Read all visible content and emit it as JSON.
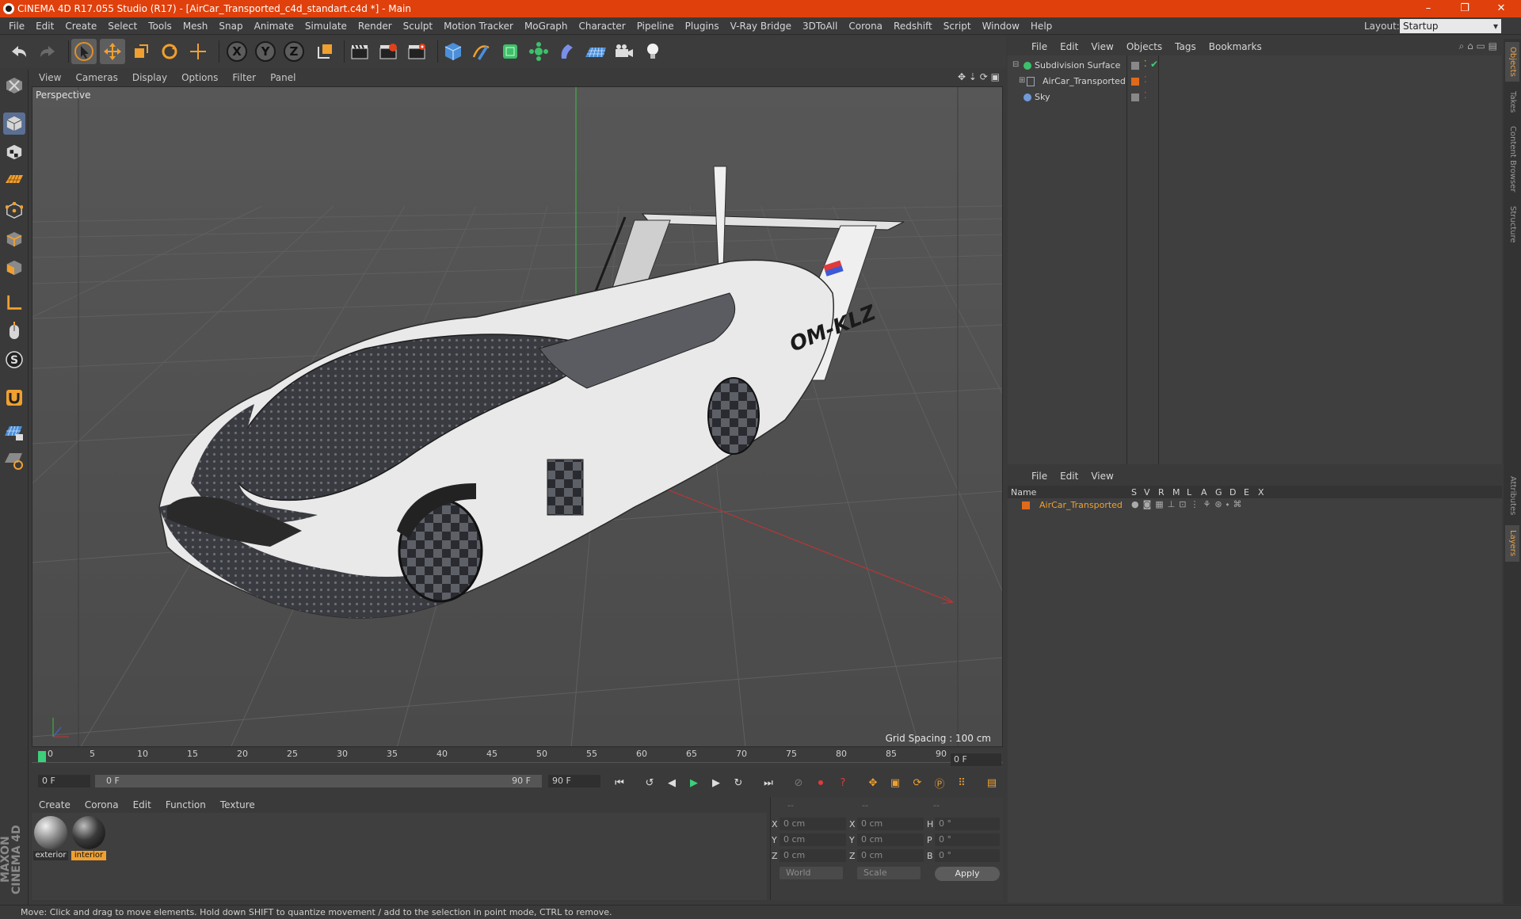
{
  "window": {
    "title": "CINEMA 4D R17.055 Studio (R17) - [AirCar_Transported_c4d_standart.c4d *] - Main",
    "controls": [
      "–",
      "❐",
      "✕"
    ]
  },
  "menubar": {
    "items": [
      "File",
      "Edit",
      "Create",
      "Select",
      "Tools",
      "Mesh",
      "Snap",
      "Animate",
      "Simulate",
      "Render",
      "Sculpt",
      "Motion Tracker",
      "MoGraph",
      "Character",
      "Pipeline",
      "Plugins",
      "V-Ray Bridge",
      "3DToAll",
      "Corona",
      "Redshift",
      "Script",
      "Window",
      "Help"
    ],
    "layout_label": "Layout:",
    "layout_value": "Startup"
  },
  "toolbar": {
    "axis_x": "X",
    "axis_y": "Y",
    "axis_z": "Z"
  },
  "viewport": {
    "menu": [
      "View",
      "Cameras",
      "Display",
      "Options",
      "Filter",
      "Panel"
    ],
    "label": "Perspective",
    "grid_spacing": "Grid Spacing : 100 cm",
    "registration": "OM-KLZ"
  },
  "timeline": {
    "ticks": [
      "0",
      "5",
      "10",
      "15",
      "20",
      "25",
      "30",
      "35",
      "40",
      "45",
      "50",
      "55",
      "60",
      "65",
      "70",
      "75",
      "80",
      "85",
      "90"
    ],
    "frame_end_box": "0 F",
    "start_field": "0 F",
    "range_left": "0 F",
    "range_right": "90 F",
    "end_field": "90 F"
  },
  "material_manager": {
    "menu": [
      "Create",
      "Corona",
      "Edit",
      "Function",
      "Texture"
    ],
    "materials": [
      {
        "name": "exterior",
        "selected": false
      },
      {
        "name": "interior",
        "selected": true
      }
    ]
  },
  "coordinates": {
    "header": [
      "--",
      "--",
      "--"
    ],
    "rows": [
      {
        "l1": "X",
        "v1": "0 cm",
        "l2": "X",
        "v2": "0 cm",
        "l3": "H",
        "v3": "0 °"
      },
      {
        "l1": "Y",
        "v1": "0 cm",
        "l2": "Y",
        "v2": "0 cm",
        "l3": "P",
        "v3": "0 °"
      },
      {
        "l1": "Z",
        "v1": "0 cm",
        "l2": "Z",
        "v2": "0 cm",
        "l3": "B",
        "v3": "0 °"
      }
    ],
    "mode": "World",
    "scale": "Scale",
    "apply": "Apply"
  },
  "status": "Move: Click and drag to move elements. Hold down SHIFT to quantize movement / add to the selection in point mode, CTRL to remove.",
  "maxon_logo": "MAXON CINEMA 4D",
  "object_manager": {
    "menu": [
      "File",
      "Edit",
      "View",
      "Objects",
      "Tags",
      "Bookmarks"
    ],
    "objects": [
      {
        "name": "Subdivision Surface",
        "color": "#3fbf6a"
      },
      {
        "name": "AirCar_Transported",
        "color": "#9aa7b8"
      },
      {
        "name": "Sky",
        "color": "#6f9ad8"
      }
    ]
  },
  "attribute_manager": {
    "menu": [
      "File",
      "Edit",
      "View"
    ],
    "columns": [
      "Name",
      "S",
      "V",
      "R",
      "M",
      "L",
      "A",
      "G",
      "D",
      "E",
      "X"
    ],
    "layer_name": "AirCar_Transported",
    "layer_color": "#e06a1c"
  },
  "right_tabs": [
    "Objects",
    "Takes",
    "Content Browser",
    "Structure",
    "Attributes",
    "Layers"
  ],
  "colors": {
    "titlebar": "#e0400c",
    "accent_orange": "#f0a030",
    "selection_blue": "#5a6f93"
  }
}
